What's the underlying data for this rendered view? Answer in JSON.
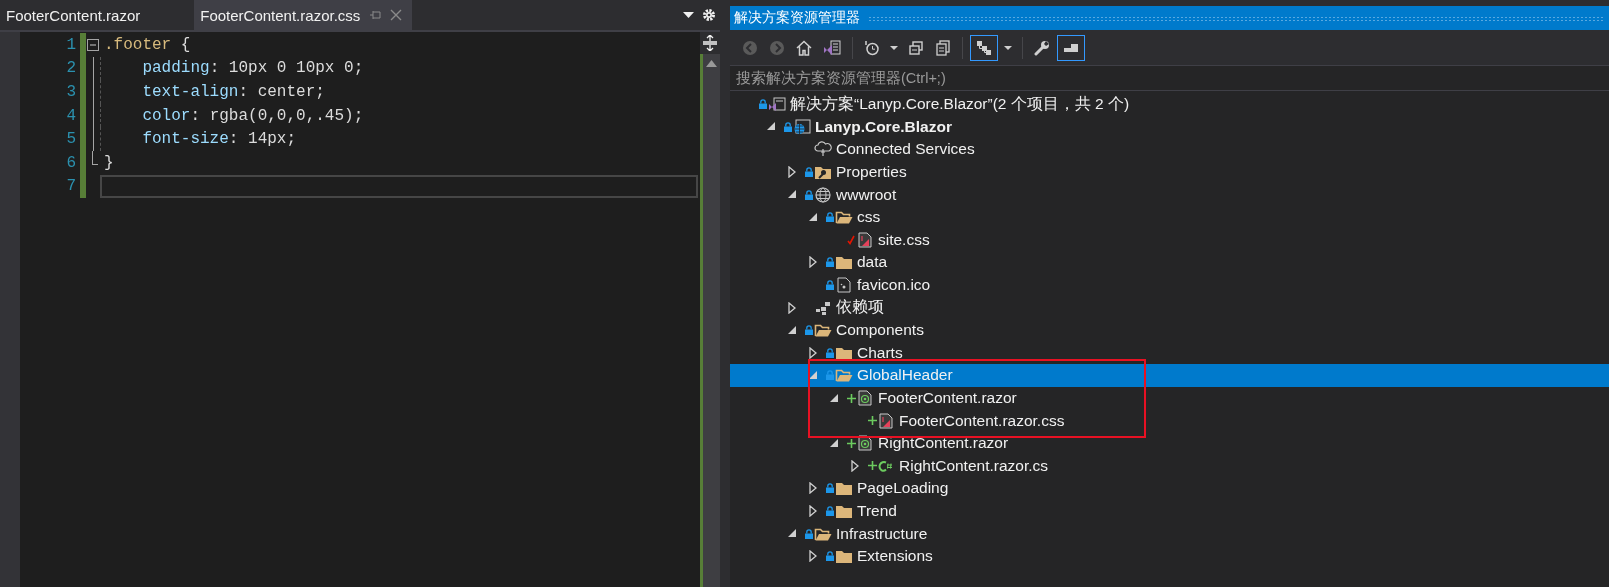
{
  "editor": {
    "tabs": [
      {
        "label": "FooterContent.razor",
        "selected": false
      },
      {
        "label": "FooterContent.razor.css",
        "selected": true
      }
    ],
    "lines": [
      {
        "number": "1",
        "kind": "fold-start",
        "changed": true,
        "current": false,
        "tokens": [
          {
            "kind": "selector",
            "text": ".footer"
          },
          {
            "kind": "plain",
            "text": " {"
          }
        ]
      },
      {
        "number": "2",
        "kind": "fold-inside",
        "changed": true,
        "current": false,
        "tokens": [
          {
            "kind": "property",
            "text": "    padding"
          },
          {
            "kind": "plain",
            "text": ": 10px 0 10px 0;"
          }
        ]
      },
      {
        "number": "3",
        "kind": "fold-inside",
        "changed": true,
        "current": false,
        "tokens": [
          {
            "kind": "property",
            "text": "    text-align"
          },
          {
            "kind": "plain",
            "text": ": center;"
          }
        ]
      },
      {
        "number": "4",
        "kind": "fold-inside",
        "changed": true,
        "current": false,
        "tokens": [
          {
            "kind": "property",
            "text": "    color"
          },
          {
            "kind": "plain",
            "text": ": rgba(0,0,0,.45);"
          }
        ]
      },
      {
        "number": "5",
        "kind": "fold-inside",
        "changed": true,
        "current": false,
        "tokens": [
          {
            "kind": "property",
            "text": "    font-size"
          },
          {
            "kind": "plain",
            "text": ": 14px;"
          }
        ]
      },
      {
        "number": "6",
        "kind": "fold-end",
        "changed": true,
        "current": false,
        "tokens": [
          {
            "kind": "plain",
            "text": "}"
          }
        ]
      },
      {
        "number": "7",
        "kind": "plain",
        "changed": true,
        "current": true
      }
    ]
  },
  "explorer": {
    "title": "解决方案资源管理器",
    "toolbar": [
      {
        "kind": "back",
        "disabled": true,
        "selected": false
      },
      {
        "kind": "forward",
        "disabled": true,
        "selected": false
      },
      {
        "kind": "home",
        "disabled": false,
        "selected": false
      },
      {
        "kind": "switch-views",
        "disabled": false,
        "selected": false
      },
      {
        "kind": "separator"
      },
      {
        "kind": "history",
        "disabled": false,
        "selected": false
      },
      {
        "kind": "dropdown",
        "disabled": false,
        "selected": false
      },
      {
        "kind": "collapse",
        "disabled": false,
        "selected": false
      },
      {
        "kind": "copy",
        "disabled": false,
        "selected": false
      },
      {
        "kind": "separator"
      },
      {
        "kind": "sync",
        "disabled": false,
        "selected": true
      },
      {
        "kind": "dropdown",
        "disabled": false,
        "selected": false
      },
      {
        "kind": "separator"
      },
      {
        "kind": "properties",
        "disabled": false,
        "selected": false
      },
      {
        "kind": "preview",
        "disabled": false,
        "selected": true
      }
    ],
    "search": {
      "placeholder": "搜索解决方案资源管理器(Ctrl+;)"
    },
    "tree": [
      {
        "kind": "solution",
        "label": "解决方案“Lanyp.Core.Blazor”(2 个项目，共 2 个)",
        "status": {
          "kind": "locked"
        },
        "selected": false,
        "outlined": false,
        "children": [
          {
            "kind": "project",
            "label": "Lanyp.Core.Blazor",
            "status": {
              "kind": "locked"
            },
            "expanded": true,
            "selected": false,
            "outlined": false,
            "children": [
              {
                "kind": "service",
                "label": "Connected Services",
                "selected": false,
                "outlined": false
              },
              {
                "kind": "properties-folder",
                "label": "Properties",
                "status": {
                  "kind": "locked"
                },
                "expanded": false,
                "selected": false,
                "outlined": false
              },
              {
                "kind": "web-folder",
                "label": "wwwroot",
                "status": {
                  "kind": "locked"
                },
                "expanded": true,
                "selected": false,
                "outlined": false,
                "children": [
                  {
                    "kind": "folder",
                    "label": "css",
                    "status": {
                      "kind": "locked"
                    },
                    "expanded": true,
                    "selected": false,
                    "outlined": false,
                    "children": [
                      {
                        "kind": "css-file",
                        "label": "site.css",
                        "status": {
                          "kind": "checked-out"
                        },
                        "selected": false,
                        "outlined": false
                      }
                    ]
                  },
                  {
                    "kind": "folder",
                    "label": "data",
                    "status": {
                      "kind": "locked"
                    },
                    "expanded": false,
                    "selected": false,
                    "outlined": false
                  },
                  {
                    "kind": "file",
                    "label": "favicon.ico",
                    "status": {
                      "kind": "locked"
                    },
                    "selected": false,
                    "outlined": false
                  }
                ]
              },
              {
                "kind": "dependencies",
                "label": "依赖项",
                "expanded": false,
                "selected": false,
                "outlined": false
              },
              {
                "kind": "folder",
                "label": "Components",
                "status": {
                  "kind": "locked"
                },
                "expanded": true,
                "selected": false,
                "outlined": false,
                "children": [
                  {
                    "kind": "folder",
                    "label": "Charts",
                    "status": {
                      "kind": "locked"
                    },
                    "expanded": false,
                    "selected": false,
                    "outlined": false
                  },
                  {
                    "kind": "folder",
                    "label": "GlobalHeader",
                    "status": {
                      "kind": "locked"
                    },
                    "expanded": true,
                    "selected": true,
                    "outlined": true,
                    "children": [
                      {
                        "kind": "razor-file",
                        "label": "FooterContent.razor",
                        "status": {
                          "kind": "added"
                        },
                        "expanded": true,
                        "selected": false,
                        "outlined": true,
                        "children": [
                          {
                            "kind": "css-file",
                            "label": "FooterContent.razor.css",
                            "status": {
                              "kind": "added"
                            },
                            "selected": false,
                            "outlined": true
                          }
                        ]
                      },
                      {
                        "kind": "razor-file",
                        "label": "RightContent.razor",
                        "status": {
                          "kind": "added"
                        },
                        "expanded": true,
                        "selected": false,
                        "outlined": false,
                        "children": [
                          {
                            "kind": "csharp-file",
                            "label": "RightContent.razor.cs",
                            "status": {
                              "kind": "added"
                            },
                            "expanded": false,
                            "selected": false,
                            "outlined": false
                          }
                        ]
                      }
                    ]
                  },
                  {
                    "kind": "folder",
                    "label": "PageLoading",
                    "status": {
                      "kind": "locked"
                    },
                    "expanded": false,
                    "selected": false,
                    "outlined": false
                  },
                  {
                    "kind": "folder",
                    "label": "Trend",
                    "status": {
                      "kind": "locked"
                    },
                    "expanded": false,
                    "selected": false,
                    "outlined": false
                  }
                ]
              },
              {
                "kind": "folder",
                "label": "Infrastructure",
                "status": {
                  "kind": "locked"
                },
                "expanded": true,
                "selected": false,
                "outlined": false,
                "children": [
                  {
                    "kind": "folder",
                    "label": "Extensions",
                    "status": {
                      "kind": "locked"
                    },
                    "expanded": false,
                    "selected": false,
                    "outlined": false
                  }
                ]
              }
            ]
          }
        ]
      }
    ]
  }
}
